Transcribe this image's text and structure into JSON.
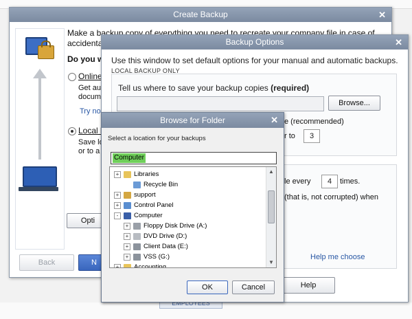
{
  "background": {
    "employees_tab": "EMPLOYEES"
  },
  "create_backup": {
    "title": "Create Backup",
    "intro_line1": "Make a backup copy of everything you need to recreate your company file in case of",
    "intro_line2": "accidental lo",
    "question": "Do you wa",
    "online_label": "Online ba",
    "online_desc1": "Get autor",
    "online_desc2": "documen",
    "try_now": "Try now o",
    "local_label": "Local b",
    "local_desc1": "Save lo",
    "local_desc2": "or to a f",
    "options_btn": "Opti",
    "back_btn": "Back",
    "next_btn": "N"
  },
  "backup_options": {
    "title": "Backup Options",
    "intro": "Use this window to set default options for your manual and automatic backups.",
    "section_label": "LOCAL BACKUP ONLY",
    "tell_text": "Tell us where to save your backup copies",
    "tell_required": "(required)",
    "path_value": "",
    "browse_btn": "Browse...",
    "recommended_text": "e (recommended)",
    "limit_prefix": "r to",
    "limit_value": "3",
    "every_prefix": "le every",
    "times_value": "4",
    "times_suffix": "times.",
    "verify_text": "(that is, not corrupted) when",
    "help_link": "Help me choose",
    "help_btn": "Help"
  },
  "browse_folder": {
    "title": "Browse for Folder",
    "prompt": "Select a location for your backups",
    "selected": "Computer",
    "tree": [
      {
        "label": "Libraries",
        "expander": "+",
        "icon": "libraries-icon",
        "color": "#e8c45a"
      },
      {
        "label": "Recycle Bin",
        "expander": "",
        "icon": "recycle-bin-icon",
        "color": "#6b9bd6"
      },
      {
        "label": "support",
        "expander": "+",
        "icon": "user-folder-icon",
        "color": "#d4a742"
      },
      {
        "label": "Control Panel",
        "expander": "+",
        "icon": "control-panel-icon",
        "color": "#5a8ed0"
      },
      {
        "label": "Computer",
        "expander": "-",
        "icon": "computer-icon",
        "color": "#3a5fa8"
      },
      {
        "label": "Floppy Disk Drive (A:)",
        "expander": "+",
        "icon": "floppy-icon",
        "color": "#9aa0a8"
      },
      {
        "label": "DVD Drive (D:)",
        "expander": "+",
        "icon": "dvd-icon",
        "color": "#b8bcc2"
      },
      {
        "label": "Client Data (E:)",
        "expander": "+",
        "icon": "network-drive-icon",
        "color": "#8c939c"
      },
      {
        "label": "VSS (G:)",
        "expander": "+",
        "icon": "network-drive-icon",
        "color": "#8c939c"
      },
      {
        "label": "Accounting",
        "expander": "+",
        "icon": "folder-icon",
        "color": "#e8c45a"
      }
    ],
    "ok_btn": "OK",
    "cancel_btn": "Cancel"
  }
}
